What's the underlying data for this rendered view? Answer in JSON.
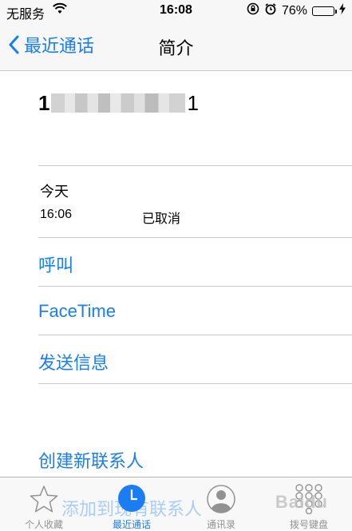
{
  "status": {
    "carrier": "无服务",
    "time": "16:08",
    "battery": "76%",
    "battery_level": 0.76
  },
  "nav": {
    "back_label": "最近通话",
    "title": "简介"
  },
  "contact": {
    "number_prefix": "1",
    "number_suffix": "1"
  },
  "call_log": {
    "date": "今天",
    "time": "16:06",
    "status": "已取消"
  },
  "actions": {
    "call": "呼叫",
    "facetime": "FaceTime",
    "message": "发送信息",
    "create_contact": "创建新联系人",
    "add_existing": "添加到现有联系人"
  },
  "tabs": [
    {
      "label": "个人收藏",
      "icon": "star-icon"
    },
    {
      "label": "最近通话",
      "icon": "clock-icon"
    },
    {
      "label": "通讯录",
      "icon": "person-icon"
    },
    {
      "label": "拨号键盘",
      "icon": "keypad-icon"
    }
  ],
  "watermark": "Baidu",
  "colors": {
    "accent": "#1a7ef2",
    "battery": "#4cd964"
  }
}
